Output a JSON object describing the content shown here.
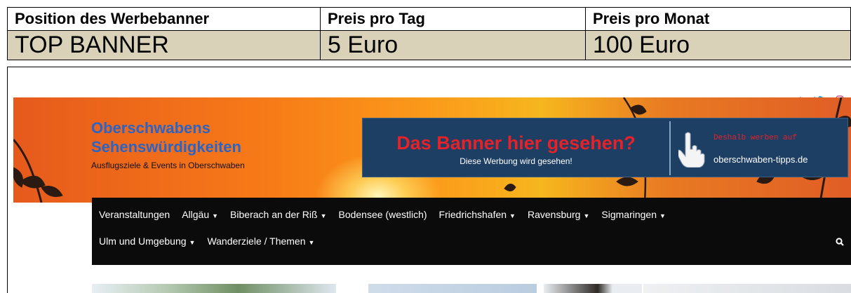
{
  "price_table": {
    "headers": [
      "Position des Werbebanner",
      "Preis pro Tag",
      "Preis pro Monat"
    ],
    "row": [
      "TOP BANNER",
      "5 Euro",
      "100 Euro"
    ]
  },
  "social": {
    "facebook": "f",
    "twitter": "🐦",
    "instagram": "◎"
  },
  "brand": {
    "title_line1": "Oberschwabens",
    "title_line2": "Sehenswürdigkeiten",
    "subtitle": "Ausflugsziele & Events in Oberschwaben"
  },
  "ad": {
    "title": "Das Banner hier gesehen?",
    "subtitle": "Diese Werbung wird gesehen!",
    "kicker": "Deshalb werben auf",
    "url": "oberschwaben-tipps.de"
  },
  "nav": {
    "row1": [
      {
        "label": "Veranstaltungen",
        "dropdown": false
      },
      {
        "label": "Allgäu",
        "dropdown": true
      },
      {
        "label": "Biberach an der Riß",
        "dropdown": true
      },
      {
        "label": "Bodensee (westlich)",
        "dropdown": false
      },
      {
        "label": "Friedrichshafen",
        "dropdown": true
      },
      {
        "label": "Ravensburg",
        "dropdown": true
      },
      {
        "label": "Sigmaringen",
        "dropdown": true
      }
    ],
    "row2": [
      {
        "label": "Ulm und Umgebung",
        "dropdown": true
      },
      {
        "label": "Wanderziele / Themen",
        "dropdown": true
      }
    ]
  },
  "colors": {
    "brand_blue": "#2b64c4",
    "ad_red": "#e5212a",
    "ad_bg": "#1d3f63",
    "nav_bg": "#0b0b0b",
    "price_row_bg": "#d9d2b8"
  }
}
